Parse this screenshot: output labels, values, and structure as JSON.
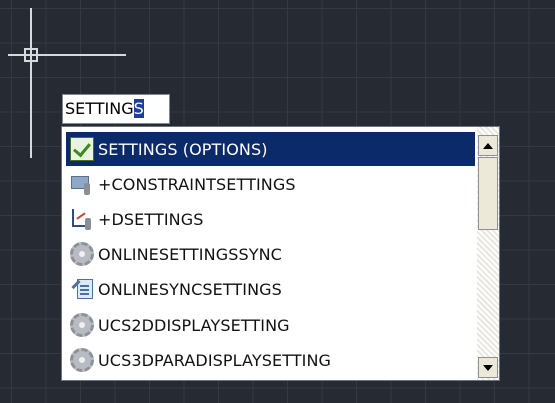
{
  "command_line": {
    "typed_text": "SETTING",
    "caret_char": "S"
  },
  "autocomplete": {
    "items": [
      {
        "label": "SETTINGS (OPTIONS)",
        "icon": "options-check-icon",
        "selected": true
      },
      {
        "label": "+CONSTRAINTSETTINGS",
        "icon": "constraint-settings-icon",
        "selected": false
      },
      {
        "label": "+DSETTINGS",
        "icon": "drafting-settings-icon",
        "selected": false
      },
      {
        "label": "ONLINESETTINGSSYNC",
        "icon": "gear-icon",
        "selected": false
      },
      {
        "label": "ONLINESYNCSETTINGS",
        "icon": "sync-settings-icon",
        "selected": false
      },
      {
        "label": "UCS2DDISPLAYSETTING",
        "icon": "gear-icon",
        "selected": false
      },
      {
        "label": "UCS3DPARADISPLAYSETTING",
        "icon": "gear-icon",
        "selected": false
      }
    ]
  },
  "colors": {
    "canvas_bg": "#252a33",
    "grid_line": "#333945",
    "selection_bg": "#0b2a6a",
    "crosshair": "#d6d9df"
  }
}
